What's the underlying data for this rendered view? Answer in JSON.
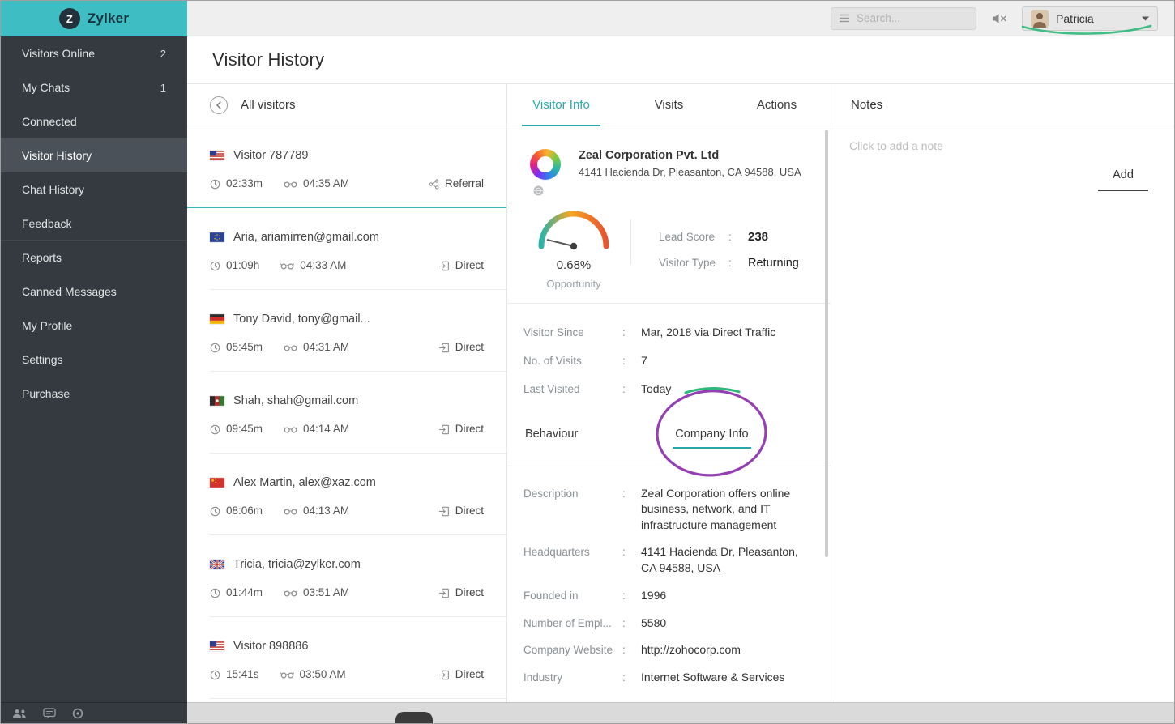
{
  "colors": {
    "accent_teal": "#3ebdc3",
    "active_tab_teal": "#2aa7ac",
    "annotation_purple": "#9440b3",
    "annotation_green": "#2eb87a",
    "sidebar_bg": "#343a40"
  },
  "brand": {
    "logo_letter": "Z",
    "name": "Zylker"
  },
  "topbar": {
    "search_placeholder": "Search...",
    "user": {
      "name": "Patricia"
    }
  },
  "page": {
    "title": "Visitor History"
  },
  "sidebar": {
    "items": [
      {
        "label": "Visitors Online",
        "badge": "2"
      },
      {
        "label": "My Chats",
        "badge": "1"
      },
      {
        "label": "Connected",
        "divider_after": true
      },
      {
        "label": "Visitor History",
        "active": true
      },
      {
        "label": "Chat History"
      },
      {
        "label": "Feedback",
        "divider_after": true
      },
      {
        "label": "Reports"
      },
      {
        "label": "Canned Messages"
      },
      {
        "label": "My Profile"
      },
      {
        "label": "Settings"
      },
      {
        "label": "Purchase"
      }
    ]
  },
  "visitor_list": {
    "header": "All visitors",
    "items": [
      {
        "name": "Visitor 787789",
        "flag": "us",
        "duration": "02:33m",
        "time": "04:35 AM",
        "source": "Referral",
        "active": true
      },
      {
        "name": "Aria, ariamirren@gmail.com",
        "flag": "eu",
        "duration": "01:09h",
        "time": "04:33 AM",
        "source": "Direct"
      },
      {
        "name": "Tony David, tony@gmail...",
        "flag": "de",
        "duration": "05:45m",
        "time": "04:31 AM",
        "source": "Direct"
      },
      {
        "name": "Shah, shah@gmail.com",
        "flag": "af",
        "duration": "09:45m",
        "time": "04:14 AM",
        "source": "Direct"
      },
      {
        "name": "Alex Martin, alex@xaz.com",
        "flag": "cn",
        "duration": "08:06m",
        "time": "04:13 AM",
        "source": "Direct"
      },
      {
        "name": "Tricia, tricia@zylker.com",
        "flag": "gb",
        "duration": "01:44m",
        "time": "03:51 AM",
        "source": "Direct"
      },
      {
        "name": "Visitor 898886",
        "flag": "us",
        "duration": "15:41s",
        "time": "03:50 AM",
        "source": "Direct"
      }
    ]
  },
  "detail": {
    "tabs": [
      "Visitor Info",
      "Visits",
      "Actions"
    ],
    "active_tab": "Visitor Info",
    "separator": ":",
    "company": {
      "name": "Zeal Corporation Pvt. Ltd",
      "address": "4141 Hacienda Dr, Pleasanton, CA 94588, USA"
    },
    "gauge": {
      "value": "0.68%",
      "label": "Opportunity"
    },
    "stats": [
      {
        "label": "Lead Score",
        "value": "238",
        "strong": true
      },
      {
        "label": "Visitor Type",
        "value": "Returning"
      }
    ],
    "visit_rows": [
      {
        "label": "Visitor Since",
        "value": "Mar, 2018 via Direct Traffic"
      },
      {
        "label": "No. of Visits",
        "value": "7"
      },
      {
        "label": "Last Visited",
        "value": "Today"
      }
    ],
    "sub_tabs": [
      "Behaviour",
      "Company Info"
    ],
    "active_sub_tab": "Company Info",
    "company_rows": [
      {
        "label": "Description",
        "value": "Zeal Corporation offers online business, network, and IT infrastructure management"
      },
      {
        "label": "Headquarters",
        "value": "4141 Hacienda Dr, Pleasanton, CA 94588, USA"
      },
      {
        "label": "Founded in",
        "value": "1996"
      },
      {
        "label": "Number of Empl...",
        "value": "5580"
      },
      {
        "label": "Company Website",
        "value": "http://zohocorp.com"
      },
      {
        "label": "Industry",
        "value": "Internet Software & Services"
      }
    ]
  },
  "notes": {
    "title": "Notes",
    "placeholder": "Click to add a note",
    "add_label": "Add"
  }
}
